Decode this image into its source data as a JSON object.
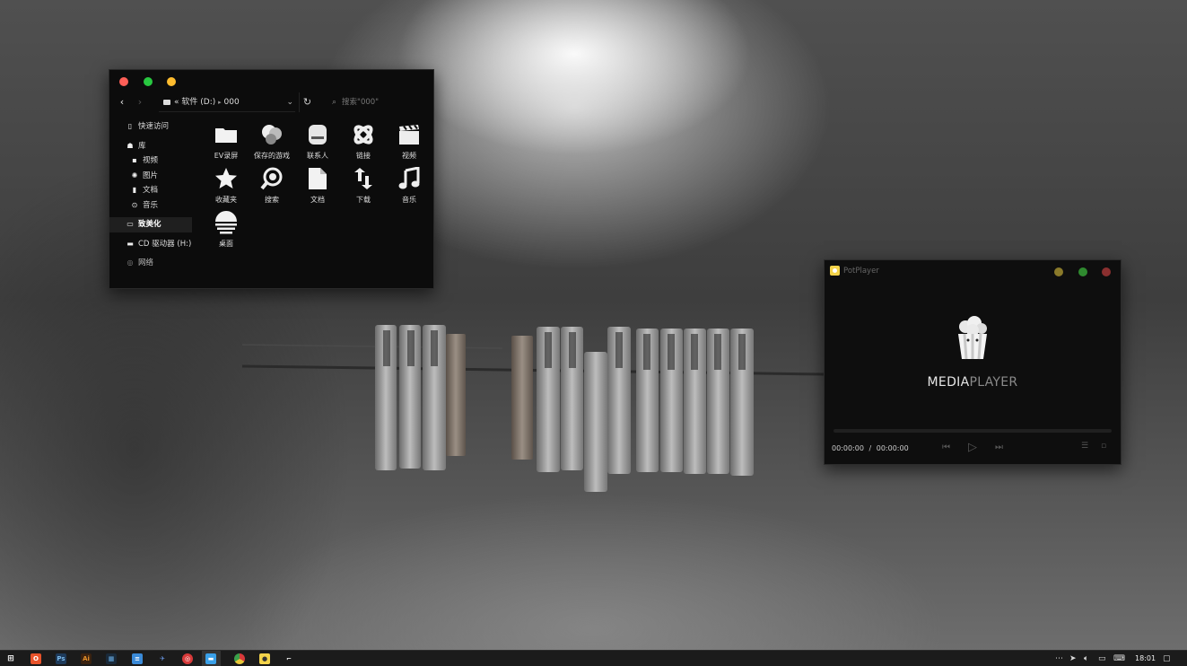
{
  "explorer": {
    "address": {
      "prefix": "«",
      "drive": "软件 (D:)",
      "separator": "▸",
      "folder": "000"
    },
    "search_placeholder": "搜索\"000\"",
    "sidebar": {
      "quick_access": "快速访问",
      "library": "库",
      "videos": "视频",
      "pictures": "图片",
      "documents": "文档",
      "music": "音乐",
      "this_pc": "致美化",
      "cd_drive": "CD 驱动器 (H:)",
      "network": "网络"
    },
    "items": [
      {
        "label": "EV录屏",
        "icon": "folder-icon"
      },
      {
        "label": "保存的游戏",
        "icon": "saved-games-icon"
      },
      {
        "label": "联系人",
        "icon": "contacts-icon"
      },
      {
        "label": "链接",
        "icon": "links-icon"
      },
      {
        "label": "视频",
        "icon": "video-clapper-icon"
      },
      {
        "label": "收藏夹",
        "icon": "star-icon"
      },
      {
        "label": "搜索",
        "icon": "search-icon"
      },
      {
        "label": "文档",
        "icon": "document-icon"
      },
      {
        "label": "下载",
        "icon": "download-icon"
      },
      {
        "label": "音乐",
        "icon": "music-note-icon"
      },
      {
        "label": "桌面",
        "icon": "desktop-icon"
      }
    ],
    "colors": {
      "close": "#ff5f57",
      "minimize": "#28c840",
      "maximize": "#febc2e"
    }
  },
  "player": {
    "title": "PotPlayer",
    "logo_bold": "MEDIA",
    "logo_light": "PLAYER",
    "current_time": "00:00:00",
    "time_separator": "/",
    "total_time": "00:00:00",
    "colors": {
      "yellow": "#8a7a2a",
      "green": "#2f8a2f",
      "red": "#8a2f2f"
    }
  },
  "taskbar": {
    "clock": "18:01",
    "apps": [
      {
        "name": "start-icon",
        "color": "#ffffff"
      },
      {
        "name": "office-icon",
        "color": "#e8532a"
      },
      {
        "name": "photoshop-icon",
        "color": "#2a5a8a"
      },
      {
        "name": "illustrator-icon",
        "color": "#c86a1a"
      },
      {
        "name": "photos-icon",
        "color": "#2a7ac8"
      },
      {
        "name": "notepad-icon",
        "color": "#3a8ad8"
      },
      {
        "name": "network-tool-icon",
        "color": "#3a6ad8"
      },
      {
        "name": "netease-music-icon",
        "color": "#d83a3a"
      },
      {
        "name": "file-explorer-icon",
        "color": "#3aa0e8"
      },
      {
        "name": "chrome-icon",
        "color": "#e8c83a"
      },
      {
        "name": "potplayer-icon",
        "color": "#f3d34a"
      },
      {
        "name": "text-cursor-icon",
        "color": "#dddddd"
      }
    ]
  }
}
